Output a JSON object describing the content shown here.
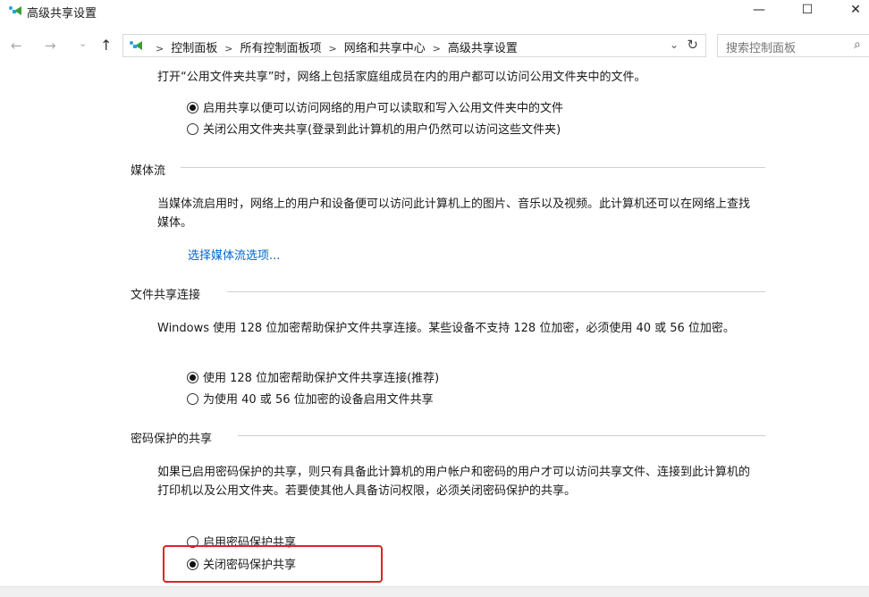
{
  "window": {
    "title": "高级共享设置",
    "minimize_glyph": "—",
    "maximize_glyph": "☐",
    "close_glyph": "✕"
  },
  "nav": {
    "back_glyph": "←",
    "forward_glyph": "→",
    "recent_glyph": "⌄",
    "up_glyph": "↑",
    "breadcrumbs": [
      "控制面板",
      "所有控制面板项",
      "网络和共享中心",
      "高级共享设置"
    ],
    "separator": ">",
    "dropdown_glyph": "⌄",
    "refresh_glyph": "↻"
  },
  "search": {
    "placeholder": "搜索控制面板",
    "icon": "search-icon"
  },
  "public_folder": {
    "description": "打开“公用文件夹共享”时，网络上包括家庭组成员在内的用户都可以访问公用文件夹中的文件。",
    "options": [
      {
        "label": "启用共享以便可以访问网络的用户可以读取和写入公用文件夹中的文件",
        "checked": true
      },
      {
        "label": "关闭公用文件夹共享(登录到此计算机的用户仍然可以访问这些文件夹)",
        "checked": false
      }
    ]
  },
  "media_streaming": {
    "heading": "媒体流",
    "description": "当媒体流启用时，网络上的用户和设备便可以访问此计算机上的图片、音乐以及视频。此计算机还可以在网络上查找媒体。",
    "link": "选择媒体流选项..."
  },
  "file_sharing": {
    "heading": "文件共享连接",
    "description": "Windows 使用 128 位加密帮助保护文件共享连接。某些设备不支持 128 位加密，必须使用 40 或 56 位加密。",
    "options": [
      {
        "label": "使用 128 位加密帮助保护文件共享连接(推荐)",
        "checked": true
      },
      {
        "label": "为使用 40 或 56 位加密的设备启用文件共享",
        "checked": false
      }
    ]
  },
  "password_protected": {
    "heading": "密码保护的共享",
    "description": "如果已启用密码保护的共享，则只有具备此计算机的用户帐户和密码的用户才可以访问共享文件、连接到此计算机的打印机以及公用文件夹。若要使其他人具备访问权限，必须关闭密码保护的共享。",
    "options": [
      {
        "label": "启用密码保护共享",
        "checked": false
      },
      {
        "label": "关闭密码保护共享",
        "checked": true
      }
    ]
  },
  "colors": {
    "link": "#0066cc",
    "highlight": "#e0202a",
    "rule": "#d0d0d0"
  }
}
